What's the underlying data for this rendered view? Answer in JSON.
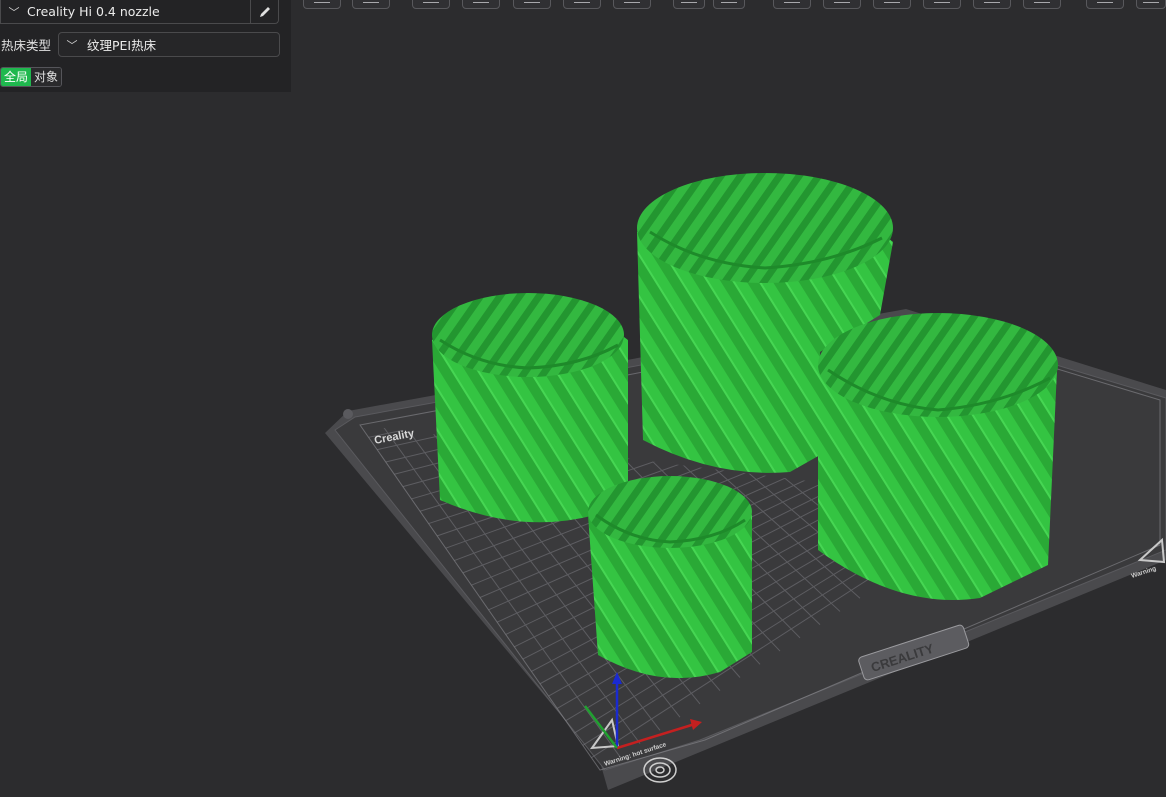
{
  "app": {
    "accent_color": "#1fb84e",
    "background_color": "#2c2c2e"
  },
  "printer": {
    "name": "Creality Hi 0.4 nozzle",
    "dropdown_icon": "chevron-down-icon",
    "edit_icon": "pencil-icon"
  },
  "bed": {
    "label": "热床类型",
    "value": "纹理PEI热床"
  },
  "scope_tabs": [
    {
      "label": "全局",
      "active": true
    },
    {
      "label": "对象",
      "active": false
    }
  ],
  "toolbar": {
    "icons": [
      "add-icon",
      "add-plate-icon",
      "orient-icon",
      "arrange-icon",
      "auto-orient-icon",
      "split-icon",
      "layout-icon",
      "move-icon",
      "rotate-icon",
      "scale-icon",
      "cut-icon",
      "support-icon",
      "seam-icon",
      "measure-icon",
      "assembly-icon",
      "text-icon",
      "variable-layer-icon",
      "view-icon"
    ]
  },
  "plate": {
    "brand_top_left": "Creality",
    "brand_bottom": "CREALITY",
    "warning_front": "Warning: hot surface",
    "warning_right": "Warning"
  },
  "model": {
    "color": "#36c443"
  }
}
